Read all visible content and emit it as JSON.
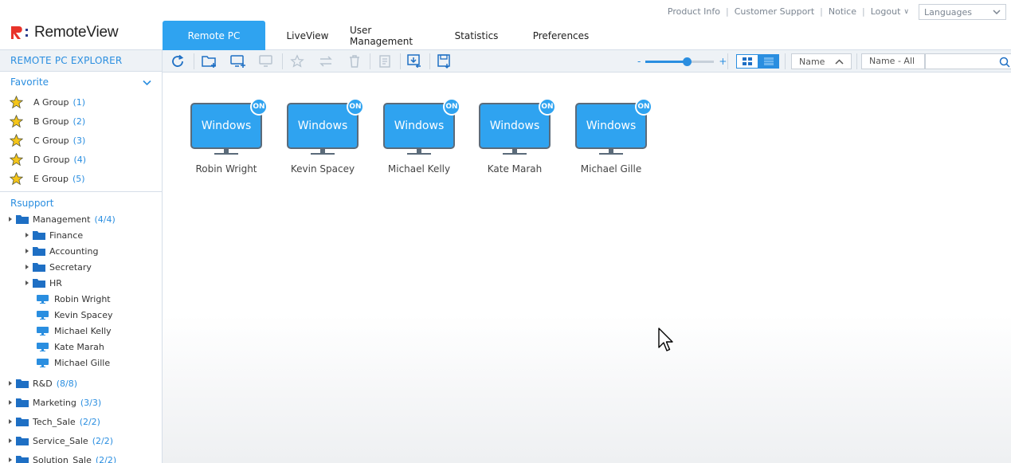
{
  "app": {
    "logo_text": "RemoteView"
  },
  "toplinks": [
    "Product Info",
    "Customer Support",
    "Notice",
    "Logout"
  ],
  "language_select": {
    "value": "Languages"
  },
  "tabs": [
    {
      "label": "Remote PC",
      "active": true
    },
    {
      "label": "LiveView"
    },
    {
      "label": "User Management"
    },
    {
      "label": "Statistics"
    },
    {
      "label": "Preferences"
    }
  ],
  "sidebar": {
    "title": "REMOTE PC EXPLORER",
    "favorite_label": "Favorite",
    "favorites": [
      {
        "label": "A Group",
        "count": "(1)"
      },
      {
        "label": "B Group",
        "count": "(2)"
      },
      {
        "label": "C Group",
        "count": "(3)"
      },
      {
        "label": "D Group",
        "count": "(4)"
      },
      {
        "label": "E Group",
        "count": "(5)"
      }
    ],
    "tree_root": "Rsupport",
    "management": {
      "label": "Management",
      "count": "(4/4)"
    },
    "subfolders": [
      "Finance",
      "Accounting",
      "Secretary",
      "HR"
    ],
    "pcs": [
      "Robin Wright",
      "Kevin Spacey",
      "Michael Kelly",
      "Kate Marah",
      "Michael Gille"
    ],
    "groups": [
      {
        "label": "R&D",
        "count": "(8/8)"
      },
      {
        "label": "Marketing",
        "count": "(3/3)"
      },
      {
        "label": "Tech_Sale",
        "count": "(2/2)"
      },
      {
        "label": "Service_Sale",
        "count": "(2/2)"
      },
      {
        "label": "Solution_Sale",
        "count": "(2/2)"
      }
    ]
  },
  "toolbar": {
    "zoom_minus": "-",
    "zoom_plus": "+",
    "zoom_level": 0.6,
    "sort_value": "Name",
    "filter_value": "Name - All",
    "search_value": ""
  },
  "main": {
    "pcs": [
      {
        "os": "Windows",
        "status": "ON",
        "name": "Robin Wright"
      },
      {
        "os": "Windows",
        "status": "ON",
        "name": "Kevin Spacey"
      },
      {
        "os": "Windows",
        "status": "ON",
        "name": "Michael Kelly"
      },
      {
        "os": "Windows",
        "status": "ON",
        "name": "Kate Marah"
      },
      {
        "os": "Windows",
        "status": "ON",
        "name": "Michael Gille"
      }
    ]
  },
  "colors": {
    "accent": "#2fa3f0",
    "link": "#2a8ee0",
    "star": "#f5c518",
    "monitor_frame": "#5b6b7a"
  }
}
